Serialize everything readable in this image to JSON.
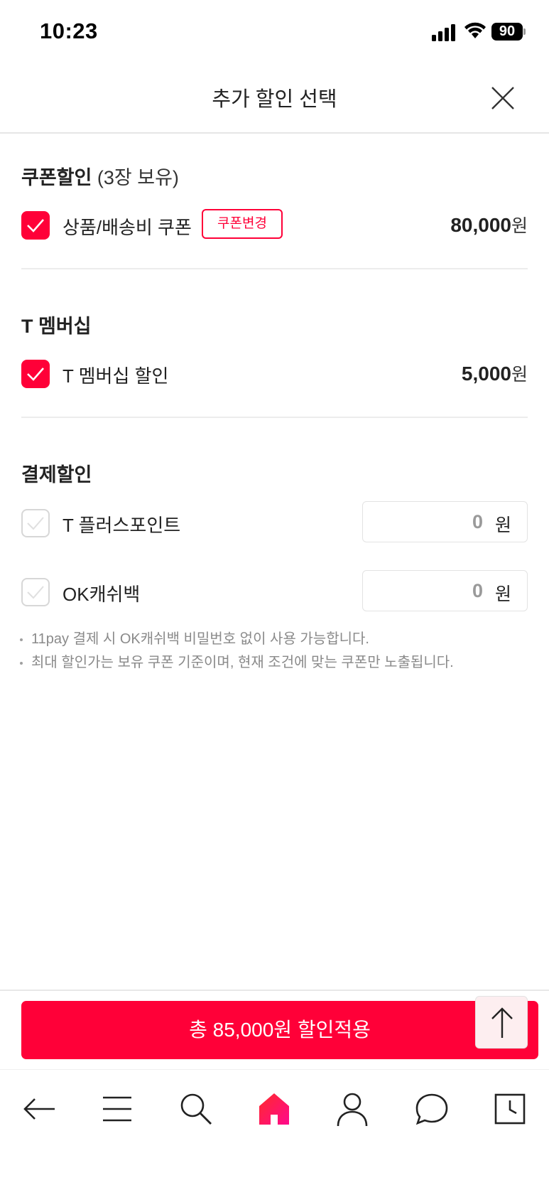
{
  "status_bar": {
    "time": "10:23",
    "battery": "90"
  },
  "header": {
    "title": "추가 할인 선택"
  },
  "coupon_section": {
    "title": "쿠폰할인",
    "subtitle": "(3장 보유)",
    "item_label": "상품/배송비 쿠폰",
    "change_button": "쿠폰변경",
    "amount": "80,000",
    "unit": "원",
    "checked": true
  },
  "membership_section": {
    "title": "T 멤버십",
    "item_label": "T 멤버십 할인",
    "amount": "5,000",
    "unit": "원",
    "checked": true
  },
  "payment_section": {
    "title": "결제할인",
    "items": [
      {
        "label": "T 플러스포인트",
        "value": "0",
        "unit": "원",
        "checked": false
      },
      {
        "label": "OK캐쉬백",
        "value": "0",
        "unit": "원",
        "checked": false
      }
    ],
    "notes": [
      "11pay 결제 시 OK캐쉬백 비밀번호 없이 사용 가능합니다.",
      "최대 할인가는 보유 쿠폰 기준이며, 현재 조건에 맞는 쿠폰만 노출됩니다."
    ]
  },
  "apply_button": {
    "label": "총 85,000원 할인적용"
  },
  "colors": {
    "accent": "#ff0038",
    "text": "#222222",
    "muted": "#8a8a8a"
  },
  "nav": {
    "icons": [
      "back-arrow-icon",
      "menu-icon",
      "search-icon",
      "home-icon",
      "profile-icon",
      "chat-icon",
      "recent-icon"
    ]
  }
}
